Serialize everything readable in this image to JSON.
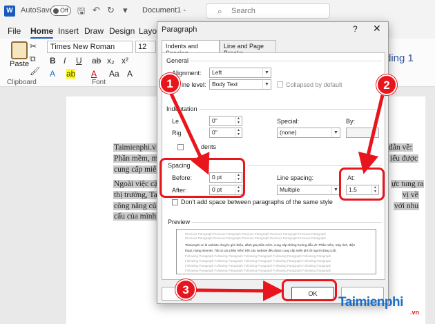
{
  "titlebar": {
    "autosave_label": "AutoSave",
    "autosave_state": "Off",
    "doc_title": "Document1",
    "doc_title_sep": "-",
    "search_placeholder": "Search"
  },
  "menu": [
    "File",
    "Home",
    "Insert",
    "Draw",
    "Design",
    "Layou"
  ],
  "ribbon": {
    "paste_label": "Paste",
    "font_name": "Times New Roman",
    "font_size": "12",
    "group_clipboard": "Clipboard",
    "group_font": "Font",
    "style_name": "ding 1"
  },
  "document": {
    "lines": [
      "Taimienphi.v",
      "Phần mềm, m",
      "cung cấp miễ",
      "Ngoài việc cậ",
      "thị trường, Ta",
      "công năng của",
      "cấu của mình",
      "dẫn về:",
      "iểu được",
      "ực tung ra",
      "vị về",
      "với nhu"
    ]
  },
  "dialog": {
    "title": "Paragraph",
    "help": "?",
    "close": "✕",
    "tabs": [
      "Indents and Spacing",
      "Line and Page Breaks"
    ],
    "general": {
      "section": "General",
      "alignment_label": "Alignment:",
      "alignment_value": "Left",
      "outline_label": "ine level:",
      "outline_value": "Body Text",
      "collapsed_label": "Collapsed by default"
    },
    "indentation": {
      "section": "Indentation",
      "left_label": "Le",
      "left_value": "0\"",
      "right_label": "Rig",
      "right_value": "0\"",
      "special_label": "Special:",
      "special_value": "(none)",
      "by_label": "By:",
      "mirror_label": "dents"
    },
    "spacing": {
      "section": "Spacing",
      "before_label": "Before:",
      "before_value": "0 pt",
      "after_label": "After:",
      "after_value": "0 pt",
      "line_spacing_label": "Line spacing:",
      "line_spacing_value": "Multiple",
      "at_label": "At:",
      "at_value": "1.5",
      "dont_add_label": "Don't add space between paragraphs of the same style"
    },
    "preview": {
      "section": "Preview",
      "prev_text": "Previous Paragraph Previous Paragraph Previous Paragraph Previous Paragraph Previous Paragraph",
      "sample_1": "Taimienphi.vn là website chuyên giới thiệu, đánh giá phần mềm, cung cấp những hướng dẫn về: Phần mềm, máy tính, điện",
      "sample_2": "thoại, mạng internet. Tất cả các phần mềm trên các website đều được cung cấp miễn phí tới người dùng cuối.",
      "next_text": "Following Paragraph Following Paragraph Following Paragraph Following Paragraph Following Paragraph"
    },
    "ok_label": "OK"
  },
  "annotations": {
    "steps": [
      "1",
      "2",
      "3"
    ],
    "color": "#e8151d"
  },
  "watermark": {
    "brand": "Taimienphi",
    "suffix": ".vn"
  },
  "colors": {
    "accent": "#185abd",
    "annotation": "#e8151d",
    "watermark": "#1a6ec8"
  }
}
